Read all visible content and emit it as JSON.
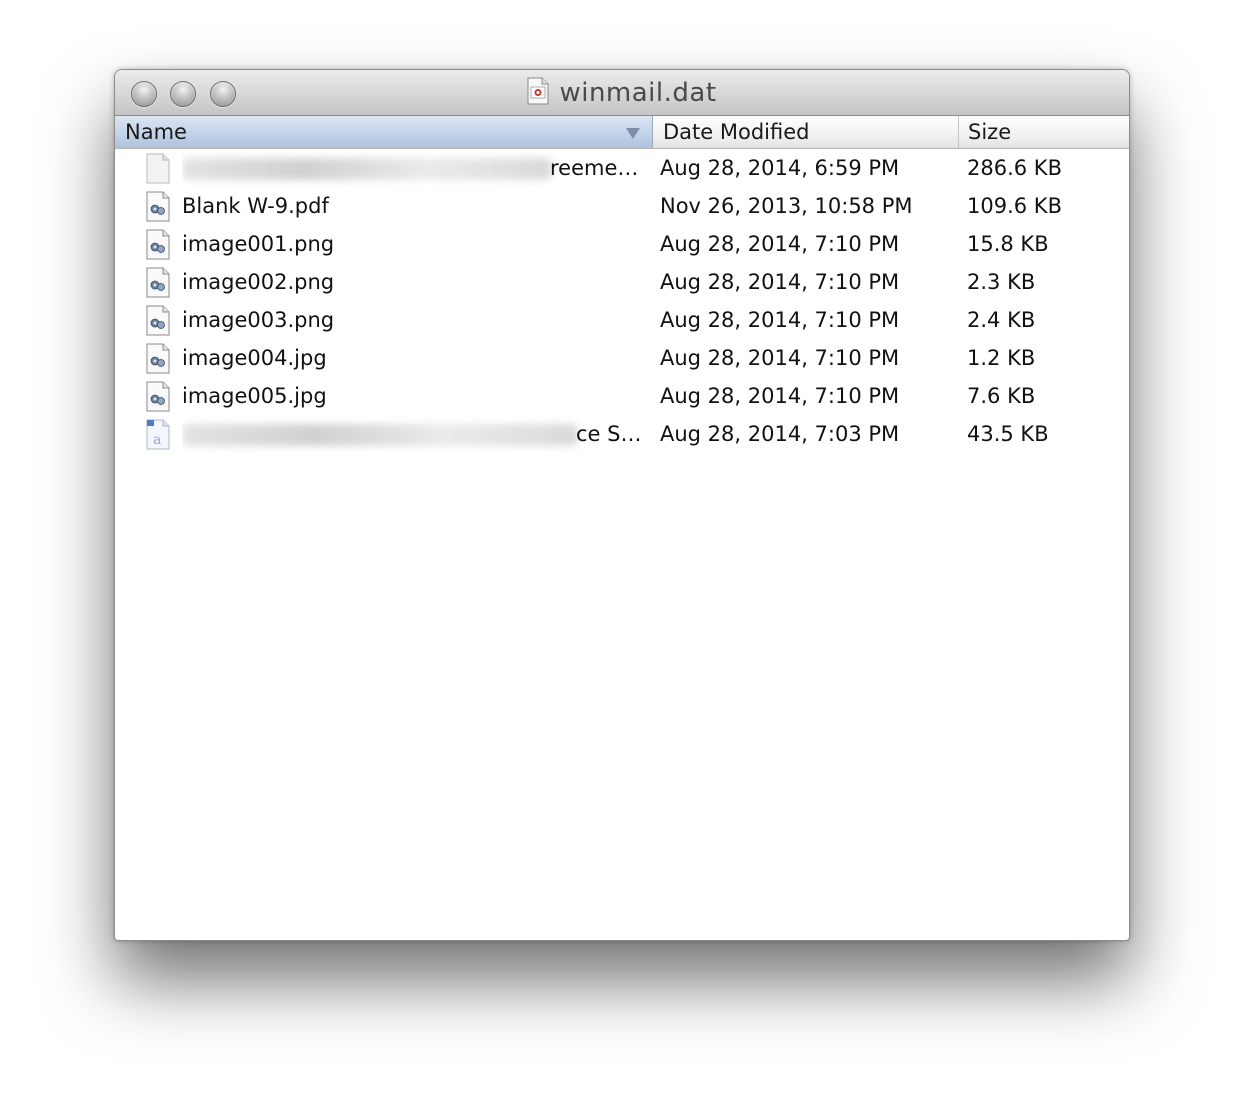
{
  "window": {
    "title": "winmail.dat",
    "title_icon": "document-viewer-icon"
  },
  "columns": {
    "name": "Name",
    "date": "Date Modified",
    "size": "Size",
    "sort": "name-descending"
  },
  "rows": [
    {
      "name_visible": "reeme…",
      "name_redacted": true,
      "date": "Aug 28, 2014, 6:59 PM",
      "size": "286.6 KB",
      "icon": "blank-document-icon"
    },
    {
      "name": "Blank W-9.pdf",
      "date": "Nov 26, 2013, 10:58 PM",
      "size": "109.6 KB",
      "icon": "preview-document-icon"
    },
    {
      "name": "image001.png",
      "date": "Aug 28, 2014, 7:10 PM",
      "size": "15.8 KB",
      "icon": "preview-document-icon"
    },
    {
      "name": "image002.png",
      "date": "Aug 28, 2014, 7:10 PM",
      "size": "2.3 KB",
      "icon": "preview-document-icon"
    },
    {
      "name": "image003.png",
      "date": "Aug 28, 2014, 7:10 PM",
      "size": "2.4 KB",
      "icon": "preview-document-icon"
    },
    {
      "name": "image004.jpg",
      "date": "Aug 28, 2014, 7:10 PM",
      "size": "1.2 KB",
      "icon": "preview-document-icon"
    },
    {
      "name": "image005.jpg",
      "date": "Aug 28, 2014, 7:10 PM",
      "size": "7.6 KB",
      "icon": "preview-document-icon"
    },
    {
      "name_visible": "ce S…",
      "name_redacted": true,
      "date": "Aug 28, 2014, 7:03 PM",
      "size": "43.5 KB",
      "icon": "word-document-icon"
    }
  ],
  "colors": {
    "selected_header": "#c3d3e8",
    "titlebar": "#d6d6d6"
  }
}
